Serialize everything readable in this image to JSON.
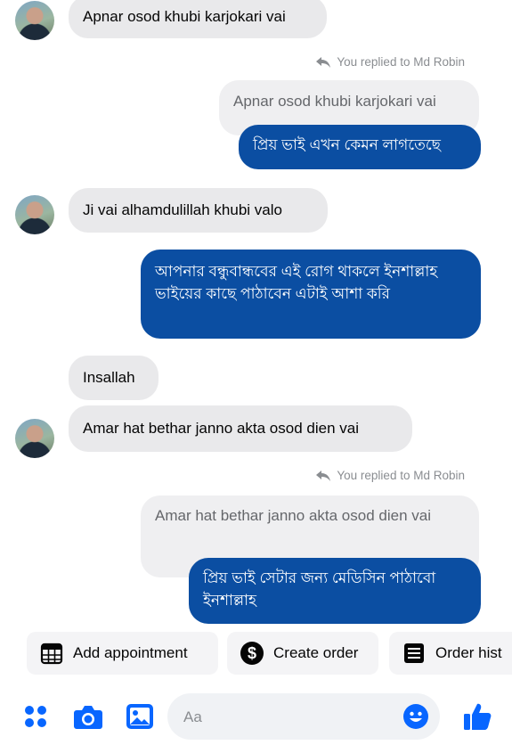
{
  "messages": [
    {
      "text": "Apnar osod khubi karjokari vai"
    },
    {
      "reply_note": "You replied to Md Robin",
      "quoted": "Apnar osod khubi karjokari vai",
      "text": "প্রিয় ভাই এখন কেমন লাগতেছে"
    },
    {
      "text": "Ji vai alhamdulillah khubi valo"
    },
    {
      "text": "আপনার বন্ধুবান্ধবের এই রোগ থাকলে ইনশাল্লাহ ভাইয়ের কাছে পাঠাবেন এটাই আশা করি"
    },
    {
      "text": "Insallah"
    },
    {
      "text": "Amar hat bethar janno akta osod dien vai"
    },
    {
      "reply_note": "You replied to Md Robin",
      "quoted": "Amar hat bethar janno akta osod dien vai",
      "text": "প্রিয় ভাই সেটার জন্য মেডিসিন পাঠাবো ইনশাল্লাহ"
    }
  ],
  "quick_actions": [
    "Add appointment",
    "Create order",
    "Order hist"
  ],
  "composer": {
    "placeholder": "Aa"
  },
  "colors": {
    "accent": "#0866ff",
    "outgoing_bubble": "#0b4ea2",
    "incoming_bubble": "#e9e9eb"
  },
  "icons": [
    "menu-icon",
    "camera-icon",
    "gallery-icon",
    "emoji-icon",
    "like-icon",
    "reply-icon",
    "calendar-icon",
    "dollar-icon",
    "receipt-icon"
  ]
}
